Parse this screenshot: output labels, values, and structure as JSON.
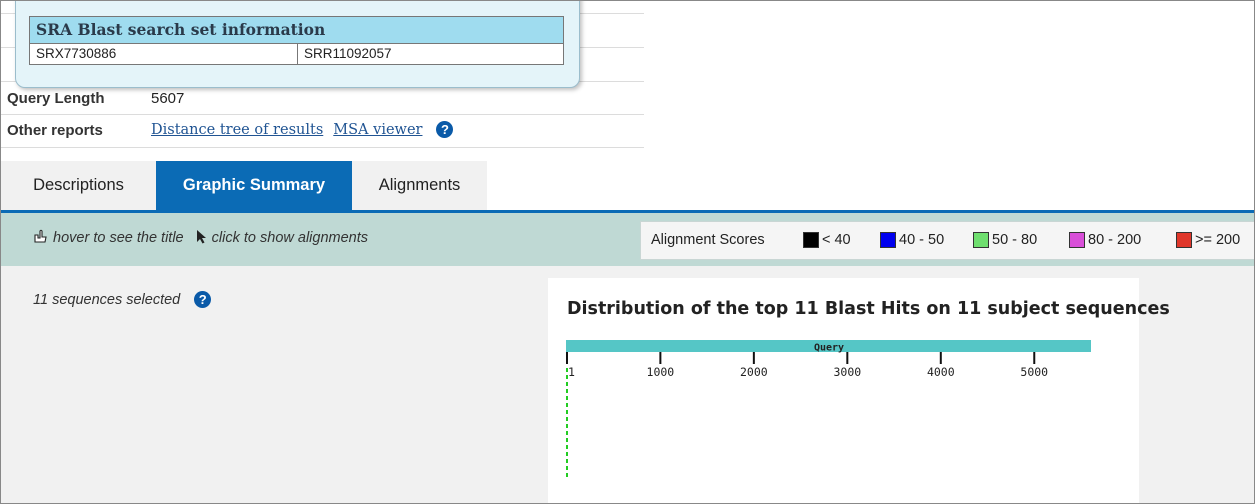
{
  "search_set": {
    "title": "SRA Blast search set information",
    "experiment": "SRX7730886",
    "run": "SRR11092057"
  },
  "info": {
    "query_length_label": "Query Length",
    "query_length_value": "5607",
    "other_reports_label": "Other reports",
    "distance_tree_link": "Distance tree of results",
    "msa_viewer_link": "MSA viewer",
    "help_glyph": "?"
  },
  "tabs": [
    {
      "label": "Descriptions",
      "active": false
    },
    {
      "label": "Graphic Summary",
      "active": true
    },
    {
      "label": "Alignments",
      "active": false
    }
  ],
  "toolbar": {
    "hover_hint": "hover to see the title",
    "click_hint": "click to show alignments",
    "hover_icon": "pointing-hand-icon",
    "click_icon": "arrow-cursor-icon"
  },
  "scores": {
    "title": "Alignment Scores",
    "items": [
      {
        "label": "< 40",
        "color": "#000000"
      },
      {
        "label": "40 - 50",
        "color": "#0000ee"
      },
      {
        "label": "50 - 80",
        "color": "#6fdf6f"
      },
      {
        "label": "80 - 200",
        "color": "#d94fd9"
      },
      {
        "label": ">= 200",
        "color": "#e0362a"
      }
    ]
  },
  "graphic": {
    "selected_text": "11 sequences selected",
    "title": "Distribution of the top 11 Blast Hits on 11 subject sequences",
    "query_label": "Query",
    "query_length": 5607,
    "bar_color": "#55c6c6",
    "hit_color": "#22cc22",
    "ticks": [
      {
        "value": 1,
        "label": "1"
      },
      {
        "value": 1000,
        "label": "1000"
      },
      {
        "value": 2000,
        "label": "2000"
      },
      {
        "value": 3000,
        "label": "3000"
      },
      {
        "value": 4000,
        "label": "4000"
      },
      {
        "value": 5000,
        "label": "5000"
      }
    ]
  }
}
